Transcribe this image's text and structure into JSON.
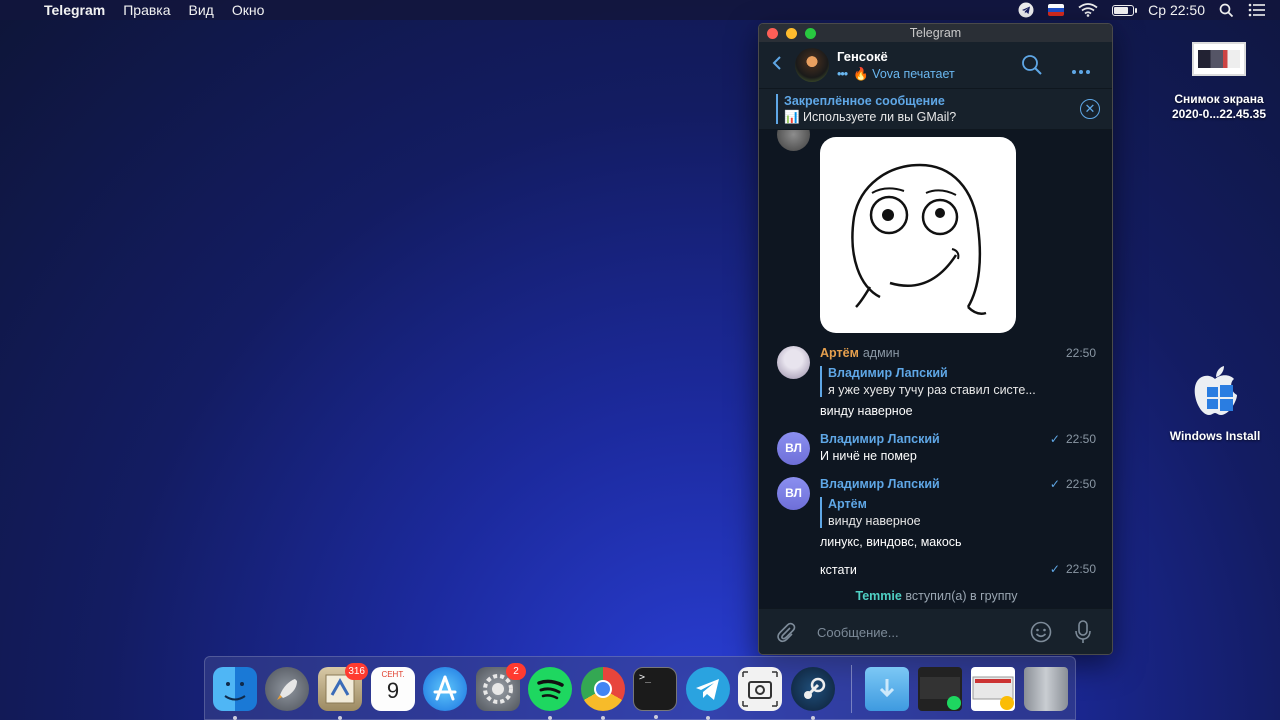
{
  "menubar": {
    "apple": "",
    "app_name": "Telegram",
    "items": [
      "Правка",
      "Вид",
      "Окно"
    ],
    "clock": "Ср 22:50"
  },
  "desktop": {
    "screenshot_label_line1": "Снимок экрана",
    "screenshot_label_line2": "2020-0...22.45.35",
    "windows_install_label": "Windows Install"
  },
  "window": {
    "title": "Telegram",
    "chat": {
      "name": "Генсокё",
      "status": "🔥 Vova печатает"
    },
    "pinned": {
      "title": "Закреплённое сообщение",
      "text": "📊 Используете ли вы GMail?"
    },
    "messages": [
      {
        "sender": "Артём",
        "role": "админ",
        "time": "22:50",
        "reply_name": "Владимир Лапский",
        "reply_text": "я уже хуеву тучу раз ставил систе...",
        "text": "винду наверное"
      },
      {
        "initials": "ВЛ",
        "sender": "Владимир Лапский",
        "time": "22:50",
        "text": "И ничё не помер"
      },
      {
        "initials": "ВЛ",
        "sender": "Владимир Лапский",
        "time": "22:50",
        "reply_name": "Артём",
        "reply_text": "винду наверное",
        "text": "линукс, виндовс, макось"
      },
      {
        "time": "22:50",
        "text": "кстати"
      }
    ],
    "service": {
      "name": "Temmie",
      "text": "вступил(а) в группу"
    },
    "composer_placeholder": "Сообщение..."
  },
  "dock": {
    "mail_badge": "316",
    "calendar_month": "СЕНТ.",
    "calendar_day": "9",
    "settings_badge": "2"
  },
  "colors": {
    "accent": "#5fa7e6",
    "window_bg": "#17212b",
    "chat_bg": "#0e1621",
    "admin_name": "#e6a04e",
    "service_name": "#4fd0c4"
  }
}
